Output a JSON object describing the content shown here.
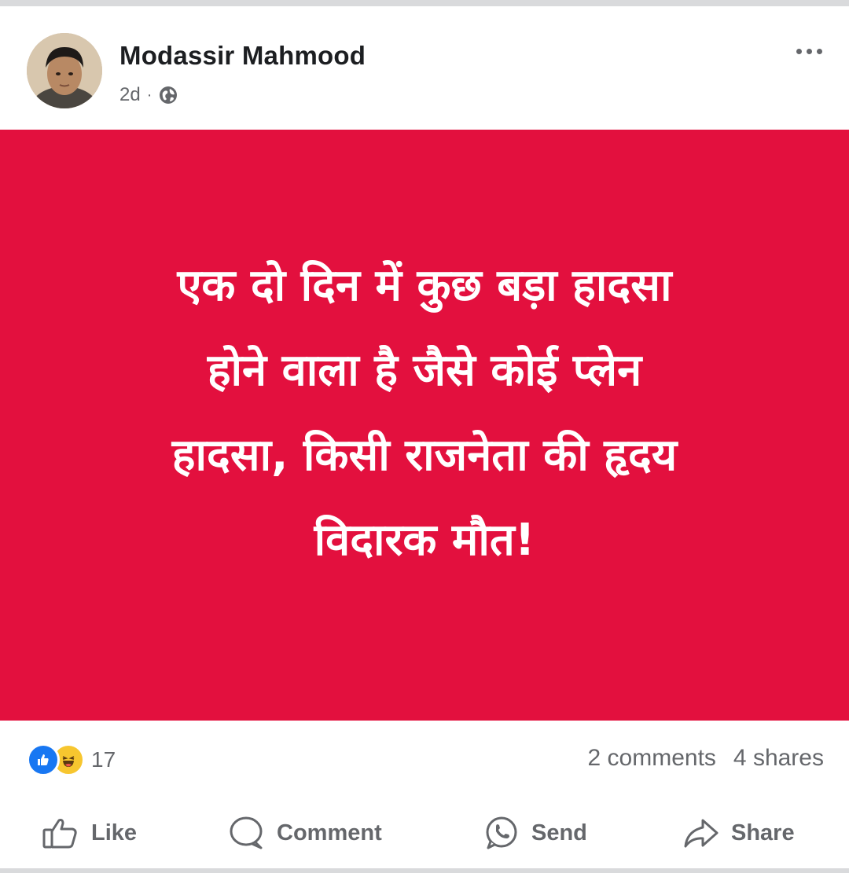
{
  "post": {
    "author": "Modassir Mahmood",
    "time": "2d",
    "separator": "·",
    "privacy_icon": "globe-icon",
    "more_icon": "more-options-icon",
    "image": {
      "background_color": "#e3103e",
      "lines": [
        "एक दो दिन में कुछ बड़ा हादसा",
        "होने वाला है जैसे कोई प्लेन",
        "हादसा, किसी राजनेता की हृदय",
        "विदारक मौत!"
      ]
    },
    "reactions": {
      "icons": [
        "like-reaction-icon",
        "haha-reaction-icon"
      ],
      "count": "17"
    },
    "comments": "2 comments",
    "shares": "4 shares"
  },
  "actions": {
    "like": "Like",
    "comment": "Comment",
    "send": "Send",
    "share": "Share"
  },
  "colors": {
    "accent": "#1877f2",
    "muted_text": "#65676b",
    "primary_text": "#1c1e21"
  }
}
